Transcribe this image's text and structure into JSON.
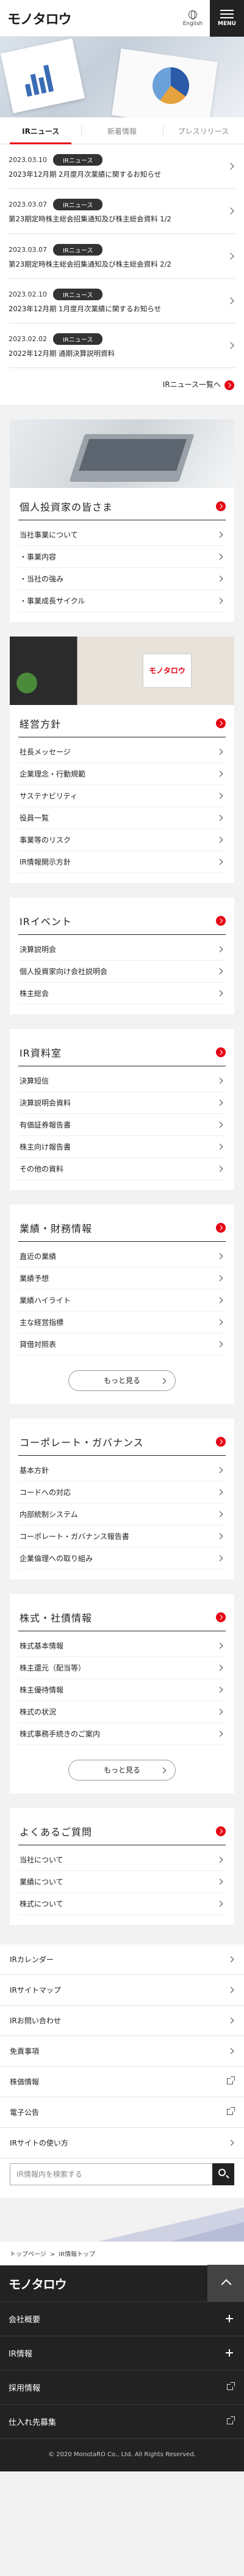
{
  "header": {
    "logo": "モノタロウ",
    "lang_label": "English",
    "menu_label": "MENU"
  },
  "tabs": [
    "IRニュース",
    "新着情報",
    "プレスリリース"
  ],
  "news": [
    {
      "date": "2023.03.10",
      "badge": "IRニュース",
      "title": "2023年12月期 2月度月次業績に関するお知らせ"
    },
    {
      "date": "2023.03.07",
      "badge": "IRニュース",
      "title": "第23期定時株主総会招集通知及び株主総会資料 1/2"
    },
    {
      "date": "2023.03.07",
      "badge": "IRニュース",
      "title": "第23期定時株主総会招集通知及び株主総会資料 2/2"
    },
    {
      "date": "2023.02.10",
      "badge": "IRニュース",
      "title": "2023年12月期 1月度月次業績に関するお知らせ"
    },
    {
      "date": "2023.02.02",
      "badge": "IRニュース",
      "title": "2022年12月期 通期決算説明資料"
    }
  ],
  "news_more": "IRニュース一覧へ",
  "cards": {
    "individual": {
      "title": "個人投資家の皆さま",
      "items": [
        "当社事業について",
        "・事業内容",
        "・当社の強み",
        "・事業成長サイクル"
      ]
    },
    "policy": {
      "title": "経営方針",
      "sign": "モノタロウ",
      "items": [
        "社長メッセージ",
        "企業理念・行動規範",
        "サステナビリティ",
        "役員一覧",
        "事業等のリスク",
        "IR情報開示方針"
      ]
    },
    "events": {
      "title": "IRイベント",
      "items": [
        "決算説明会",
        "個人投資家向け会社説明会",
        "株主総会"
      ]
    },
    "library": {
      "title": "IR資料室",
      "items": [
        "決算短信",
        "決算説明会資料",
        "有価証券報告書",
        "株主向け報告書",
        "その他の資料"
      ]
    },
    "finance": {
      "title": "業績・財務情報",
      "items": [
        "直近の業績",
        "業績予想",
        "業績ハイライト",
        "主な経営指標",
        "貸借対照表"
      ],
      "more": "もっと見る"
    },
    "governance": {
      "title": "コーポレート・ガバナンス",
      "items": [
        "基本方針",
        "コードへの対応",
        "内部統制システム",
        "コーポレート・ガバナンス報告書",
        "企業倫理への取り組み"
      ]
    },
    "stock": {
      "title": "株式・社債情報",
      "items": [
        "株式基本情報",
        "株主還元（配当等）",
        "株主優待情報",
        "株式の状況",
        "株式事務手続きのご案内"
      ],
      "more": "もっと見る"
    },
    "faq": {
      "title": "よくあるご質問",
      "items": [
        "当社について",
        "業績について",
        "株式について"
      ]
    }
  },
  "links": [
    {
      "label": "IRカレンダー",
      "icon": "chevron"
    },
    {
      "label": "IRサイトマップ",
      "icon": "chevron"
    },
    {
      "label": "IRお問い合わせ",
      "icon": "chevron"
    },
    {
      "label": "免責事項",
      "icon": "chevron"
    },
    {
      "label": "株価情報",
      "icon": "external"
    },
    {
      "label": "電子公告",
      "icon": "external"
    },
    {
      "label": "IRサイトの使い方",
      "icon": "chevron"
    }
  ],
  "search": {
    "placeholder": "IR情報内を検索する"
  },
  "breadcrumb": [
    "トップページ",
    "IR情報トップ"
  ],
  "footer": {
    "logo": "モノタロウ",
    "rows": [
      {
        "label": "会社概要",
        "icon": "plus"
      },
      {
        "label": "IR情報",
        "icon": "plus"
      },
      {
        "label": "採用情報",
        "icon": "external"
      },
      {
        "label": "仕入れ先募集",
        "icon": "external"
      }
    ],
    "copyright": "© 2020 MonotaRO Co., Ltd. All Rights Reserved."
  },
  "colors": {
    "accent": "#e60012",
    "dark": "#222222"
  }
}
